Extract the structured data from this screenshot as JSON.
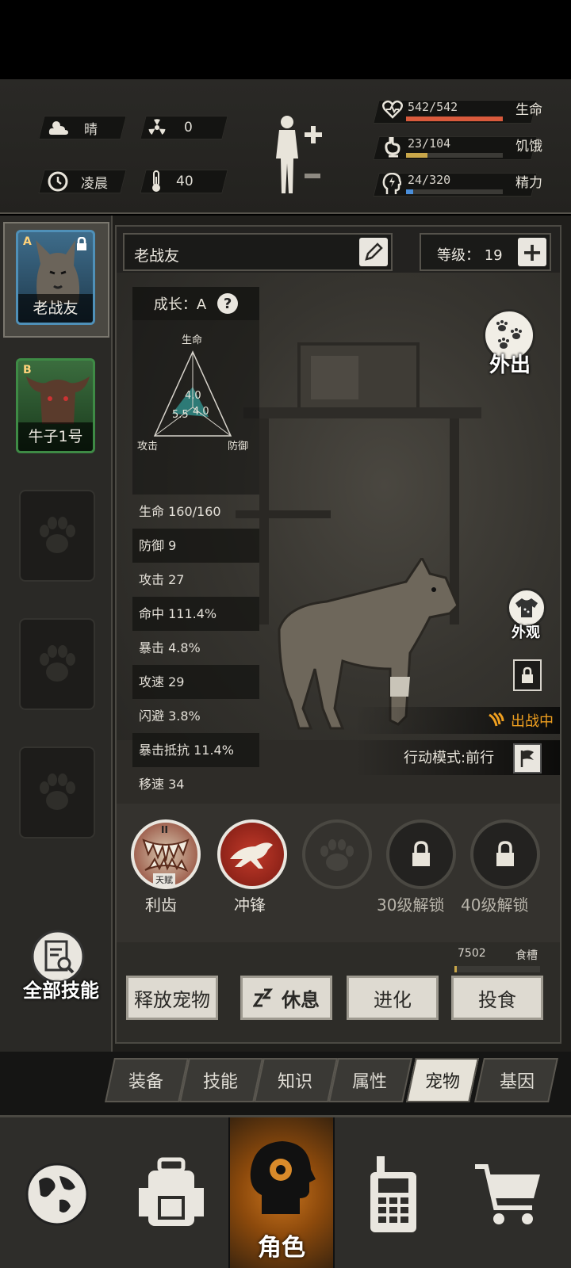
{
  "status": {
    "weather": "晴",
    "radiation": "0",
    "time_of_day": "凌晨",
    "temperature": "40",
    "health": {
      "label": "生命",
      "value": "542/542",
      "fraction": 1.0,
      "color": "#d95a3c"
    },
    "hunger": {
      "label": "饥饿",
      "value": "23/104",
      "fraction": 0.22,
      "color": "#c9a74a"
    },
    "energy": {
      "label": "精力",
      "value": "24/320",
      "fraction": 0.075,
      "color": "#4a8ed9"
    }
  },
  "pets": [
    {
      "grade": "A",
      "name": "老战友",
      "locked": true,
      "selected": true
    },
    {
      "grade": "B",
      "name": "牛子1号",
      "locked": false,
      "selected": false
    }
  ],
  "detail": {
    "name": "老战友",
    "level_text": "等级：  19",
    "growth": "成长：A",
    "radar": {
      "top": "生命",
      "left": "攻击",
      "right": "防御",
      "v_health": "4.0",
      "v_attack": "5.5",
      "v_defense": "4.0"
    },
    "stats": [
      "生命 160/160",
      "防御 9",
      "攻击 27",
      "命中 111.4%",
      "暴击 4.8%",
      "攻速 29",
      "闪避 3.8%",
      "暴击抵抗 11.4%",
      "移速 34"
    ],
    "go_out": "外出",
    "appearance": "外观",
    "battle_status": "出战中",
    "action_mode": "行动模式:前行"
  },
  "skills": [
    {
      "name": "利齿",
      "badge": "天赋",
      "rank": "II"
    },
    {
      "name": "冲锋"
    },
    {
      "name": ""
    },
    {
      "name": "30级解锁"
    },
    {
      "name": "40级解锁"
    }
  ],
  "food": {
    "amount": "7502",
    "label": "食槽",
    "fraction": 0.03
  },
  "actions": {
    "release": "释放宠物",
    "rest": "休息",
    "evolve": "进化",
    "feed": "投食"
  },
  "all_skills": "全部技能",
  "tabs": [
    "装备",
    "技能",
    "知识",
    "属性",
    "宠物",
    "基因"
  ],
  "active_tab": "宠物",
  "nav": {
    "active_label": "角色"
  }
}
